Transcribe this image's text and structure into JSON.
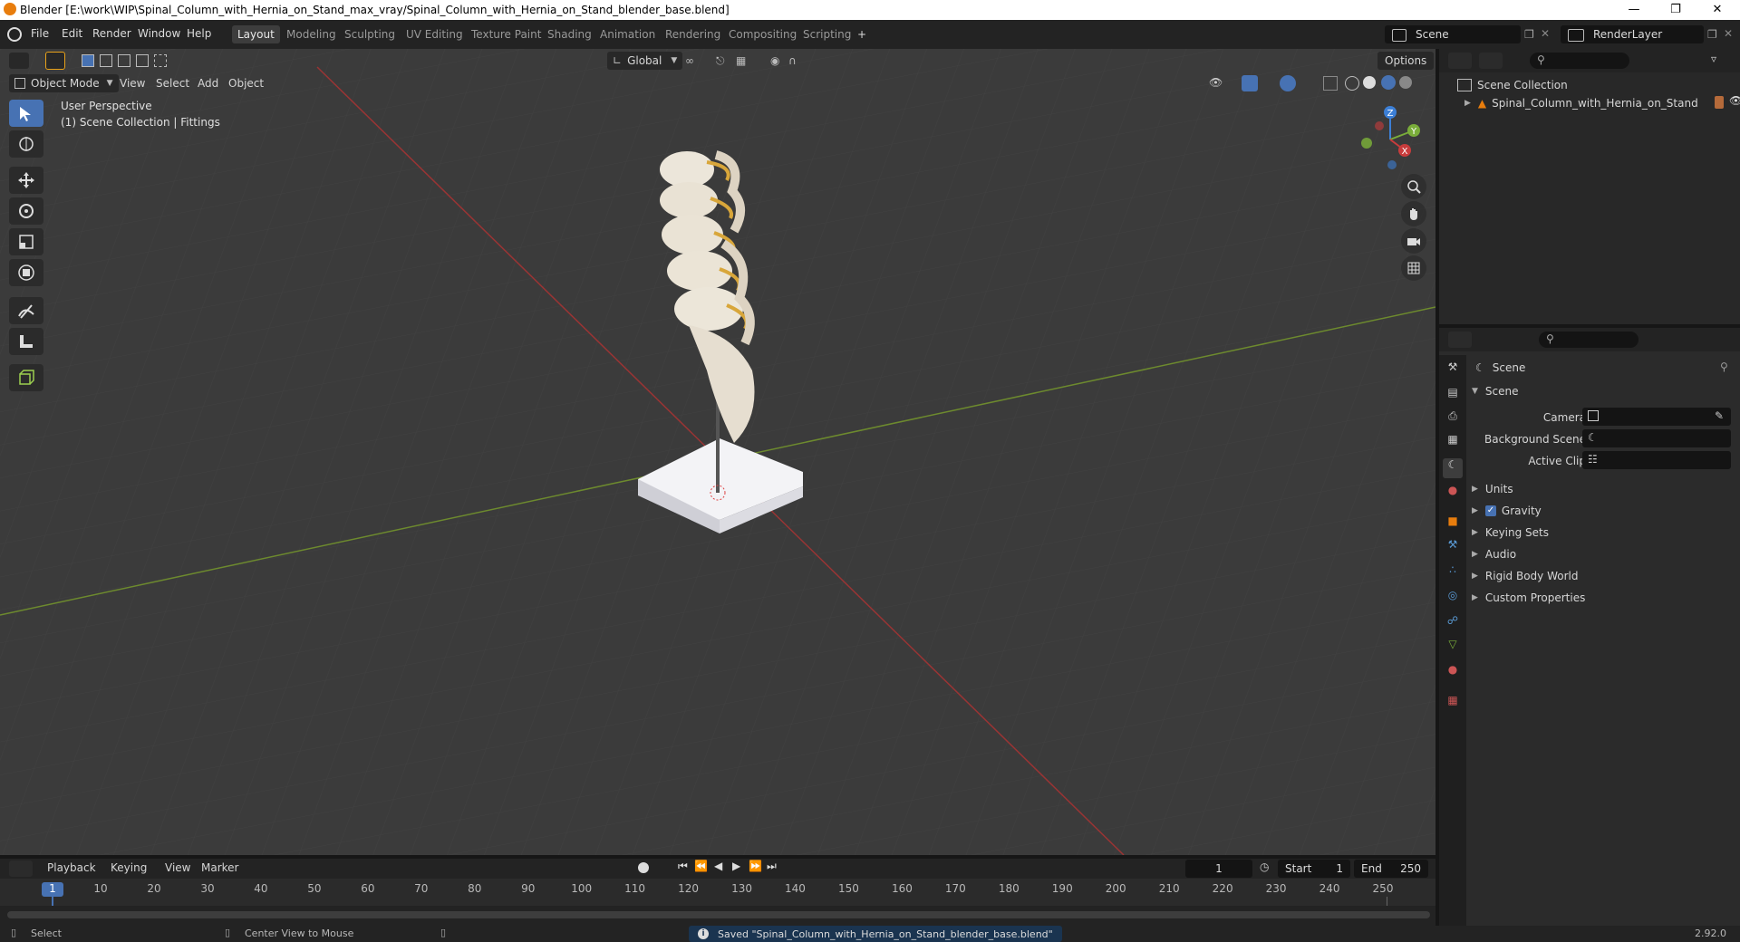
{
  "window": {
    "title": "Blender [E:\\work\\WIP\\Spinal_Column_with_Hernia_on_Stand_max_vray/Spinal_Column_with_Hernia_on_Stand_blender_base.blend]"
  },
  "menus": [
    "File",
    "Edit",
    "Render",
    "Window",
    "Help"
  ],
  "workspaces": [
    "Layout",
    "Modeling",
    "Sculpting",
    "UV Editing",
    "Texture Paint",
    "Shading",
    "Animation",
    "Rendering",
    "Compositing",
    "Scripting"
  ],
  "workspace_add": "+",
  "scene_field": "Scene",
  "renderlayer_field": "RenderLayer",
  "viewport_header": {
    "mode": "Object Mode",
    "menus": [
      "View",
      "Select",
      "Add",
      "Object"
    ],
    "transform": "Global",
    "options": "Options"
  },
  "viewport_overlay": {
    "line1": "User Perspective",
    "line2": "(1) Scene Collection | Fittings"
  },
  "gizmo": {
    "z": "Z",
    "y": "Y",
    "x": "X"
  },
  "outliner": {
    "collection": "Scene Collection",
    "item": "Spinal_Column_with_Hernia_on_Stand"
  },
  "properties": {
    "title": "Scene",
    "section": "Scene",
    "camera_label": "Camera",
    "background_label": "Background Scene",
    "clip_label": "Active Clip",
    "panels": [
      "Units",
      "Gravity",
      "Keying Sets",
      "Audio",
      "Rigid Body World",
      "Custom Properties"
    ]
  },
  "timeline": {
    "menus": [
      "Playback",
      "Keying",
      "View",
      "Marker"
    ],
    "current_frame": "1",
    "start_label": "Start",
    "start_value": "1",
    "end_label": "End",
    "end_value": "250",
    "ticks": [
      "1",
      "10",
      "20",
      "30",
      "40",
      "50",
      "60",
      "70",
      "80",
      "90",
      "100",
      "110",
      "120",
      "130",
      "140",
      "150",
      "160",
      "170",
      "180",
      "190",
      "200",
      "210",
      "220",
      "230",
      "240",
      "250"
    ]
  },
  "status": {
    "select": "Select",
    "center": "Center View to Mouse",
    "message": "Saved \"Spinal_Column_with_Hernia_on_Stand_blender_base.blend\"",
    "version": "2.92.0"
  },
  "colors": {
    "accent": "#4772b3",
    "x_axis": "#c83c3c",
    "y_axis": "#7aad3a",
    "z_axis": "#3c7fd6",
    "blender_orange": "#e87d0d"
  }
}
